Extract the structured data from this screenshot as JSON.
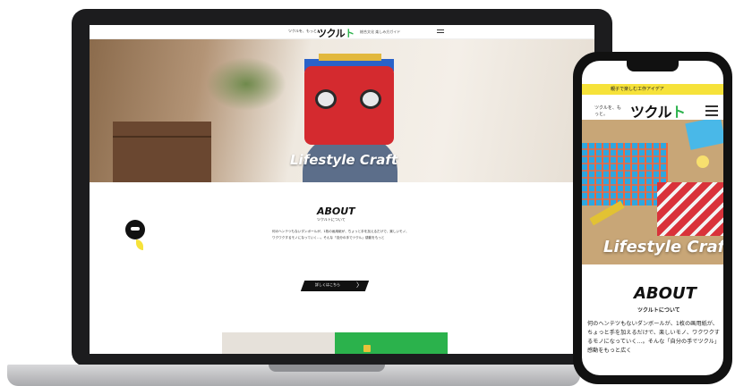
{
  "laptop": {
    "header": {
      "tagline": "ツクルを、もっと。",
      "logo_main": "ツクル",
      "logo_accent": "ト",
      "nav_text": "総合文化 楽しみ方ガイド"
    },
    "hero": {
      "title": "Lifestyle Craft"
    },
    "about": {
      "title": "ABOUT",
      "subtitle": "ツクルトについて",
      "body": "何のヘンテツもないダンボールが、1枚の画用紙が、ちょっと手を加えるだけで、楽しいモノ、ワクワクするモノになっていく…。そんな「自分の手でツクル」感動をもっと",
      "more_button": "詳しくはこちら",
      "more_arrow": "〉"
    }
  },
  "phone": {
    "banner": "親子で楽しむ工作アイデア",
    "tagline": "ツクルを、もっと。",
    "logo_main": "ツクル",
    "logo_accent": "ト",
    "hero": {
      "title": "Lifestyle Craft"
    },
    "about": {
      "title": "ABOUT",
      "subtitle": "ツクルトについて",
      "body": "何のヘンテツもないダンボールが、1枚の画用紙が、ちょっと手を加えるだけで、楽しいモノ、ワクワクするモノになっていく…。そんな「自分の手でツクル」感動をもっと広く"
    }
  },
  "colors": {
    "brand_green": "#2bb24c",
    "banner_yellow": "#f6e23a",
    "device_dark": "#1c1c1e"
  }
}
